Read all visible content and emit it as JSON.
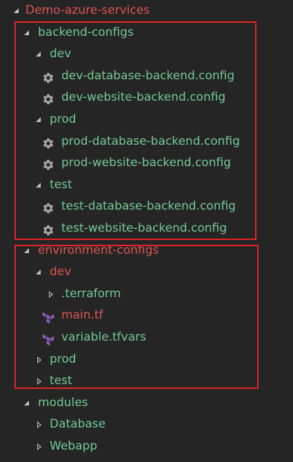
{
  "colors": {
    "background": "#252526",
    "text_clean": "#73c991",
    "text_error": "#e05252",
    "highlight_box": "#e8232b",
    "chevron": "#c5c5c5",
    "gear_icon": "#a9a9a9",
    "terraform_icon": "#8b5fbf"
  },
  "tree": [
    {
      "label": "Demo-azure-services",
      "type": "folder",
      "expanded": true,
      "status": "error",
      "depth": 0
    },
    {
      "label": "backend-configs",
      "type": "folder",
      "expanded": true,
      "status": "clean",
      "depth": 1
    },
    {
      "label": "dev",
      "type": "folder",
      "expanded": true,
      "status": "clean",
      "depth": 2
    },
    {
      "label": "dev-database-backend.config",
      "type": "file",
      "icon": "gear-icon",
      "status": "clean",
      "depth": 3
    },
    {
      "label": "dev-website-backend.config",
      "type": "file",
      "icon": "gear-icon",
      "status": "clean",
      "depth": 3
    },
    {
      "label": "prod",
      "type": "folder",
      "expanded": true,
      "status": "clean",
      "depth": 2
    },
    {
      "label": "prod-database-backend.config",
      "type": "file",
      "icon": "gear-icon",
      "status": "clean",
      "depth": 3
    },
    {
      "label": "prod-website-backend.config",
      "type": "file",
      "icon": "gear-icon",
      "status": "clean",
      "depth": 3
    },
    {
      "label": "test",
      "type": "folder",
      "expanded": true,
      "status": "clean",
      "depth": 2
    },
    {
      "label": "test-database-backend.config",
      "type": "file",
      "icon": "gear-icon",
      "status": "clean",
      "depth": 3
    },
    {
      "label": "test-website-backend.config",
      "type": "file",
      "icon": "gear-icon",
      "status": "clean",
      "depth": 3
    },
    {
      "label": "environment-configs",
      "type": "folder",
      "expanded": true,
      "status": "error",
      "depth": 1
    },
    {
      "label": "dev",
      "type": "folder",
      "expanded": true,
      "status": "error",
      "depth": 2
    },
    {
      "label": ".terraform",
      "type": "folder",
      "expanded": false,
      "status": "clean",
      "depth": 3
    },
    {
      "label": "main.tf",
      "type": "file",
      "icon": "terraform-icon",
      "status": "error",
      "depth": 3
    },
    {
      "label": "variable.tfvars",
      "type": "file",
      "icon": "terraform-icon",
      "status": "clean",
      "depth": 3
    },
    {
      "label": "prod",
      "type": "folder",
      "expanded": false,
      "status": "clean",
      "depth": 2
    },
    {
      "label": "test",
      "type": "folder",
      "expanded": false,
      "status": "clean",
      "depth": 2
    },
    {
      "label": "modules",
      "type": "folder",
      "expanded": true,
      "status": "clean",
      "depth": 1
    },
    {
      "label": "Database",
      "type": "folder",
      "expanded": false,
      "status": "clean",
      "depth": 2
    },
    {
      "label": "Webapp",
      "type": "folder",
      "expanded": false,
      "status": "clean",
      "depth": 2
    }
  ]
}
